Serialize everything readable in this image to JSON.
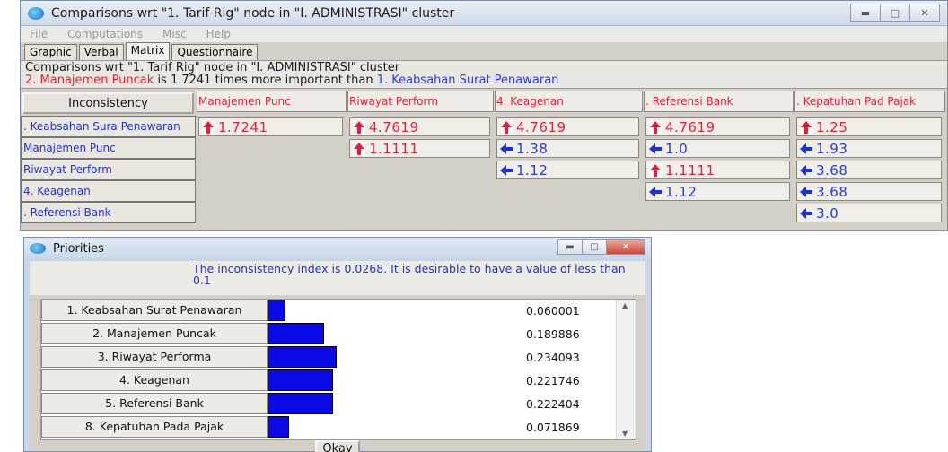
{
  "main_window": {
    "title": "Comparisons wrt \"1. Tarif Rig\" node in \"I. ADMINISTRASI\" cluster",
    "menus": [
      "File",
      "Computations",
      "Misc",
      "Help"
    ],
    "tabs": [
      "Graphic",
      "Verbal",
      "Matrix",
      "Questionnaire"
    ],
    "active_tab": "Matrix",
    "info_line1": "Comparisons wrt \"1. Tarif Rig\" node in \"I. ADMINISTRASI\" cluster",
    "info_line2": {
      "part1": "2. Manajemen Puncak",
      "part2": " is 1.7241 times more important than ",
      "part3": "1. Keabsahan Surat Penawaran"
    },
    "inconsistency_button": "Inconsistency",
    "column_headers": [
      "Manajemen Punc",
      "Riwayat Perform",
      "4. Keagenan",
      ". Referensi Bank",
      ". Kepatuhan Pad Pajak"
    ],
    "row_headers": [
      ". Keabsahan Sura Penawaran",
      "Manajemen Punc",
      "Riwayat Perform",
      "4. Keagenan",
      ". Referensi Bank"
    ],
    "cells": [
      [
        {
          "arrow": "up",
          "v": "1.7241"
        },
        {
          "arrow": "up",
          "v": "4.7619"
        },
        {
          "arrow": "up",
          "v": "4.7619"
        },
        {
          "arrow": "up",
          "v": "4.7619"
        },
        {
          "arrow": "up",
          "v": "1.25"
        }
      ],
      [
        null,
        {
          "arrow": "up",
          "v": "1.1111"
        },
        {
          "arrow": "left",
          "v": "1.38"
        },
        {
          "arrow": "left",
          "v": "1.0"
        },
        {
          "arrow": "left",
          "v": "1.93"
        }
      ],
      [
        null,
        null,
        {
          "arrow": "left",
          "v": "1.12"
        },
        {
          "arrow": "up",
          "v": "1.1111"
        },
        {
          "arrow": "left",
          "v": "3.68"
        }
      ],
      [
        null,
        null,
        null,
        {
          "arrow": "left",
          "v": "1.12"
        },
        {
          "arrow": "left",
          "v": "3.68"
        }
      ],
      [
        null,
        null,
        null,
        null,
        {
          "arrow": "left",
          "v": "3.0"
        }
      ]
    ],
    "colors": {
      "up_arrow": "#e0203a",
      "left_arrow": "#1b2fd8"
    }
  },
  "priorities": {
    "title": "Priorities",
    "message": "The inconsistency index is 0.0268.  It is desirable to have a value of less than 0.1",
    "items": [
      {
        "label": "1. Keabsahan Surat Penawaran",
        "value": "0.060001",
        "weight": 0.060001
      },
      {
        "label": "2. Manajemen Puncak",
        "value": "0.189886",
        "weight": 0.189886
      },
      {
        "label": "3. Riwayat Performa",
        "value": "0.234093",
        "weight": 0.234093
      },
      {
        "label": "4. Keagenan",
        "value": "0.221746",
        "weight": 0.221746
      },
      {
        "label": "5. Referensi Bank",
        "value": "0.222404",
        "weight": 0.222404
      },
      {
        "label": "8. Kepatuhan Pada Pajak",
        "value": "0.071869",
        "weight": 0.071869
      }
    ],
    "okay_label": "Okay",
    "bar_color": "#0a0ae8"
  }
}
